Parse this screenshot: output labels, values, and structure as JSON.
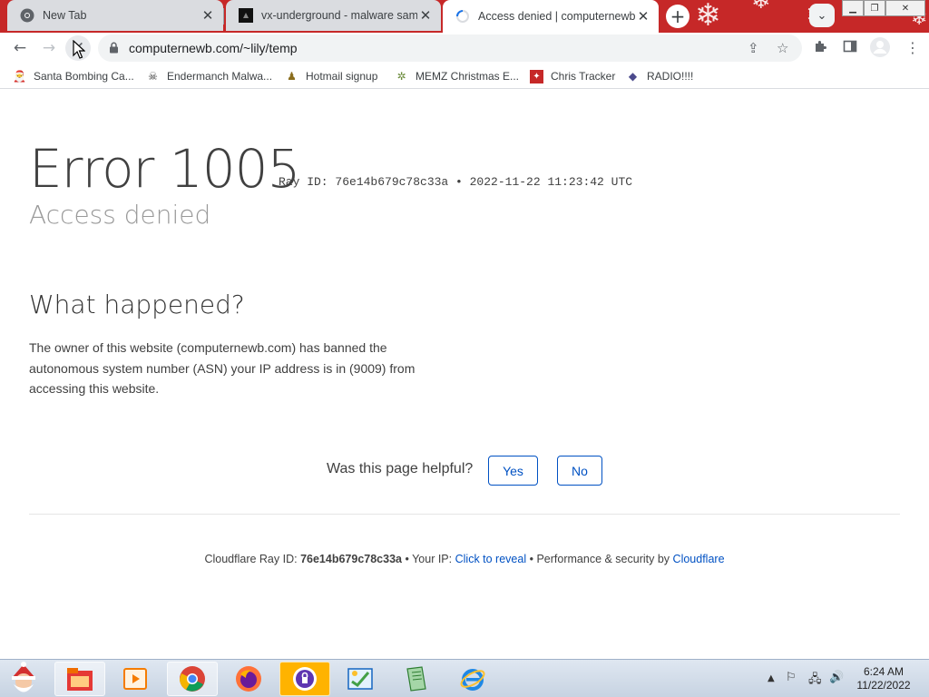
{
  "browser": {
    "tabs": [
      {
        "title": "New Tab",
        "favicon": "chrome-icon",
        "active": false
      },
      {
        "title": "vx-underground - malware samples",
        "favicon": "vx-underground-icon",
        "active": false
      },
      {
        "title": "Access denied | computernewb.com",
        "favicon": "loading-spinner-icon",
        "active": true
      }
    ],
    "address": "computernewb.com/~lily/temp",
    "bookmarks": [
      {
        "label": "Santa Bombing Ca...",
        "icon": "santa-icon"
      },
      {
        "label": "Endermanch Malwa...",
        "icon": "skull-icon"
      },
      {
        "label": "Hotmail signup",
        "icon": "person-icon"
      },
      {
        "label": "MEMZ Christmas E...",
        "icon": "memz-icon"
      },
      {
        "label": "Chris Tracker",
        "icon": "tracker-icon"
      },
      {
        "label": "RADIO!!!!",
        "icon": "radio-icon"
      }
    ],
    "accent": "#c62828"
  },
  "page": {
    "error_title": "Error 1005",
    "ray_line": "Ray ID: 76e14b679c78c33a • 2022-11-22 11:23:42 UTC",
    "subtitle": "Access denied",
    "what_heading": "What happened?",
    "description": "The owner of this website (computernewb.com) has banned the autonomous system number (ASN) your IP address is in (9009) from accessing this website.",
    "feedback": {
      "question": "Was this page helpful?",
      "yes": "Yes",
      "no": "No"
    },
    "footer": {
      "ray_label": "Cloudflare Ray ID:",
      "ray_id": "76e14b679c78c33a",
      "bullet1": "•",
      "ip_label": "Your IP:",
      "ip_link": "Click to reveal",
      "bullet2": "•",
      "perf_label": "Performance & security by",
      "cf_link": "Cloudflare"
    },
    "link_color": "#0051c3"
  },
  "taskbar": {
    "apps": [
      "santa-start-icon",
      "file-manager-icon",
      "media-player-icon",
      "chrome-icon",
      "firefox-icon",
      "vpn-shield-icon",
      "paint-icon",
      "notepad-icon",
      "internet-explorer-icon"
    ],
    "clock_time": "6:24 AM",
    "clock_date": "11/22/2022"
  }
}
